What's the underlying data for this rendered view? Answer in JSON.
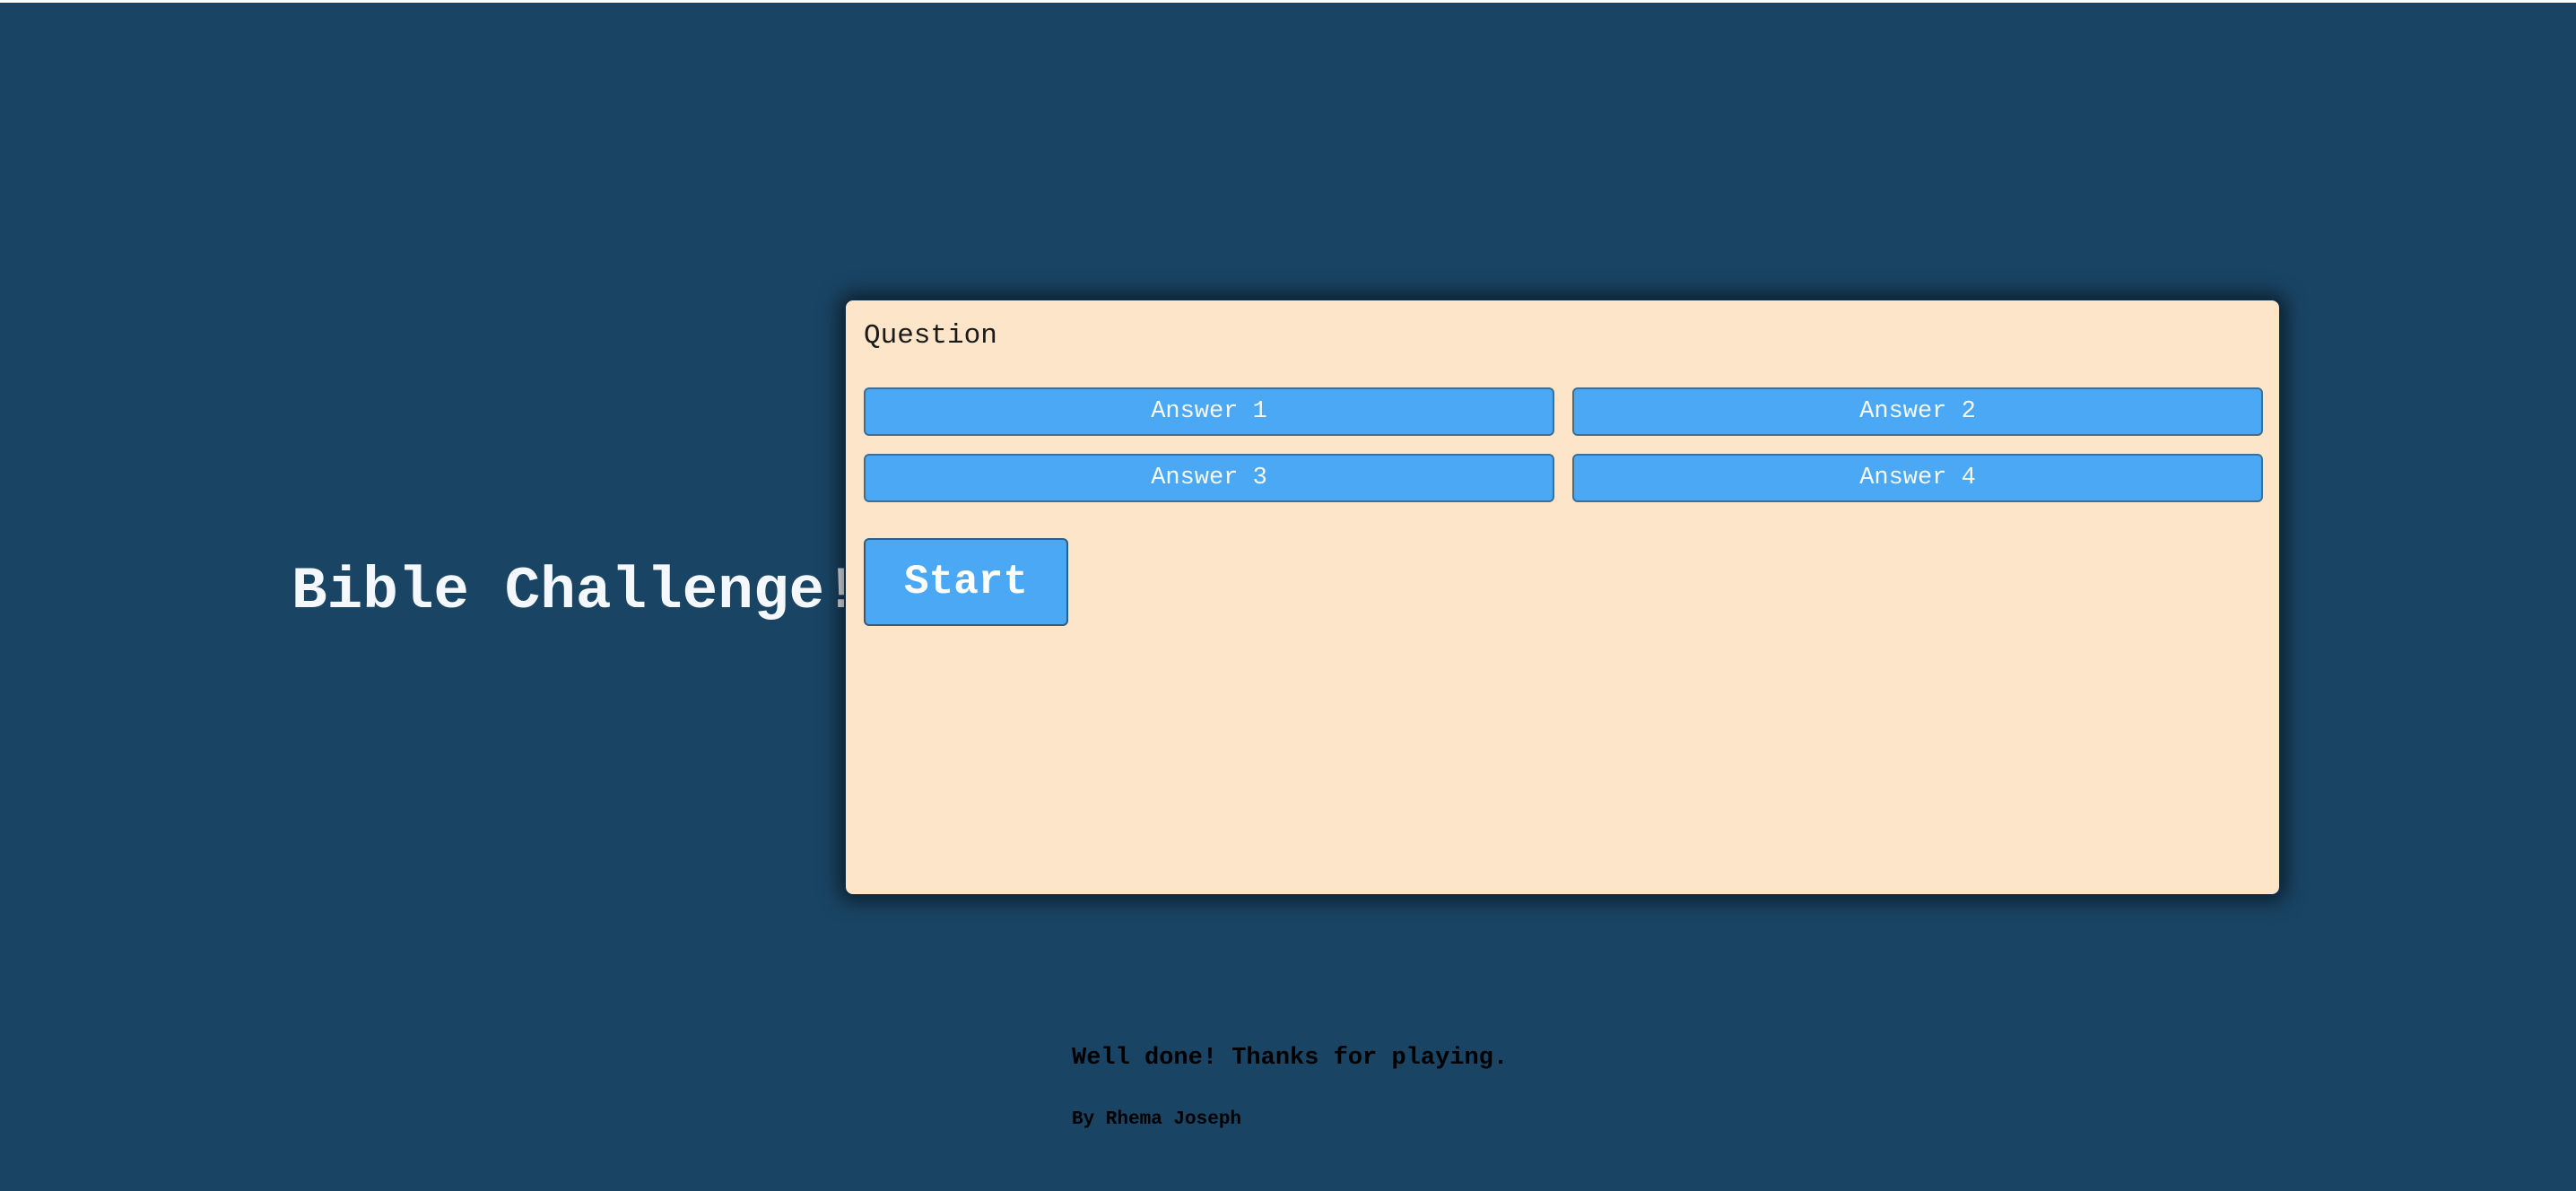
{
  "title": "Bible Challenge!",
  "quiz": {
    "question": "Question",
    "answers": [
      "Answer 1",
      "Answer 2",
      "Answer 3",
      "Answer 4"
    ],
    "start_label": "Start"
  },
  "footer": {
    "message": "Well done! Thanks for playing.",
    "author": "By Rhema Joseph"
  },
  "colors": {
    "background": "#1a4464",
    "card": "#fce5c8",
    "button": "#4aa8f5",
    "title_text": "#f4f7fb"
  }
}
